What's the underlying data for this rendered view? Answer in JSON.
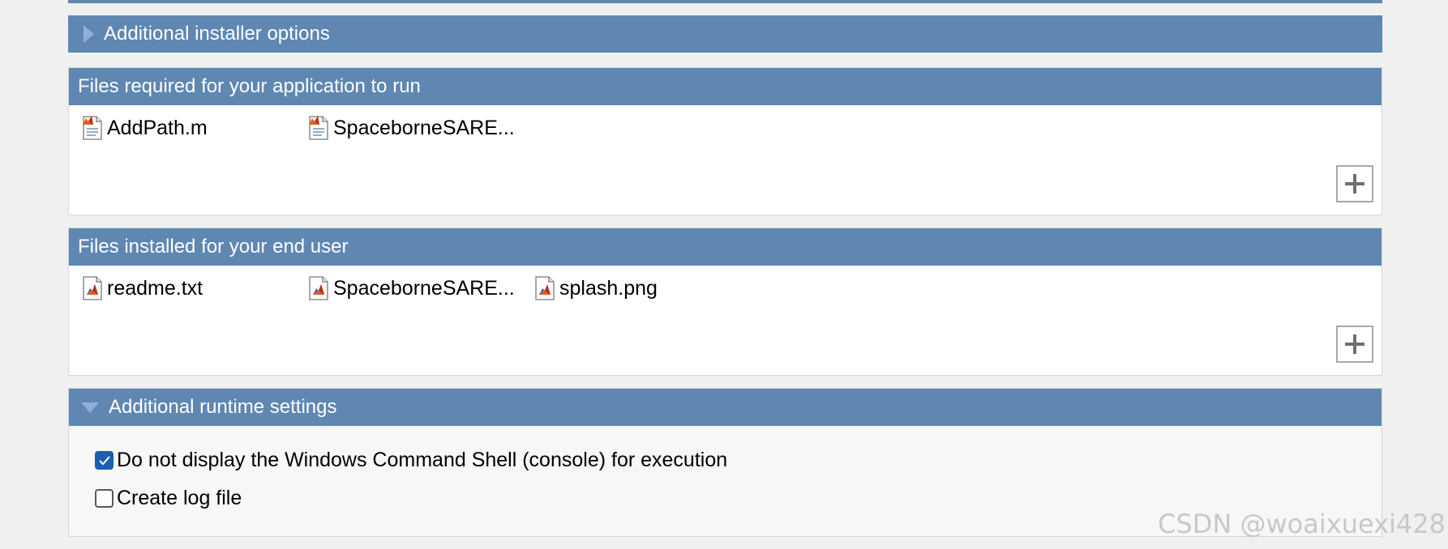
{
  "installer_options": {
    "title": "Additional installer options",
    "expanded": false
  },
  "required_files": {
    "title": "Files required for your application to run",
    "items": [
      {
        "label": "AddPath.m",
        "icon": "m-file-icon"
      },
      {
        "label": "SpaceborneSARE...",
        "icon": "m-file-icon"
      }
    ]
  },
  "installed_files": {
    "title": "Files installed for your end user",
    "items": [
      {
        "label": "readme.txt",
        "icon": "matlab-file-icon"
      },
      {
        "label": "SpaceborneSARE...",
        "icon": "matlab-file-icon"
      },
      {
        "label": "splash.png",
        "icon": "matlab-file-icon"
      }
    ]
  },
  "runtime_settings": {
    "title": "Additional runtime settings",
    "expanded": true,
    "options": [
      {
        "label": "Do not display the Windows Command Shell (console) for execution",
        "checked": true
      },
      {
        "label": "Create log file",
        "checked": false
      }
    ]
  },
  "watermark": "CSDN @woaixuexi428",
  "colors": {
    "header": "#5f87b2",
    "checkbox_on": "#1a5fb4",
    "background": "#f0f0f0"
  }
}
